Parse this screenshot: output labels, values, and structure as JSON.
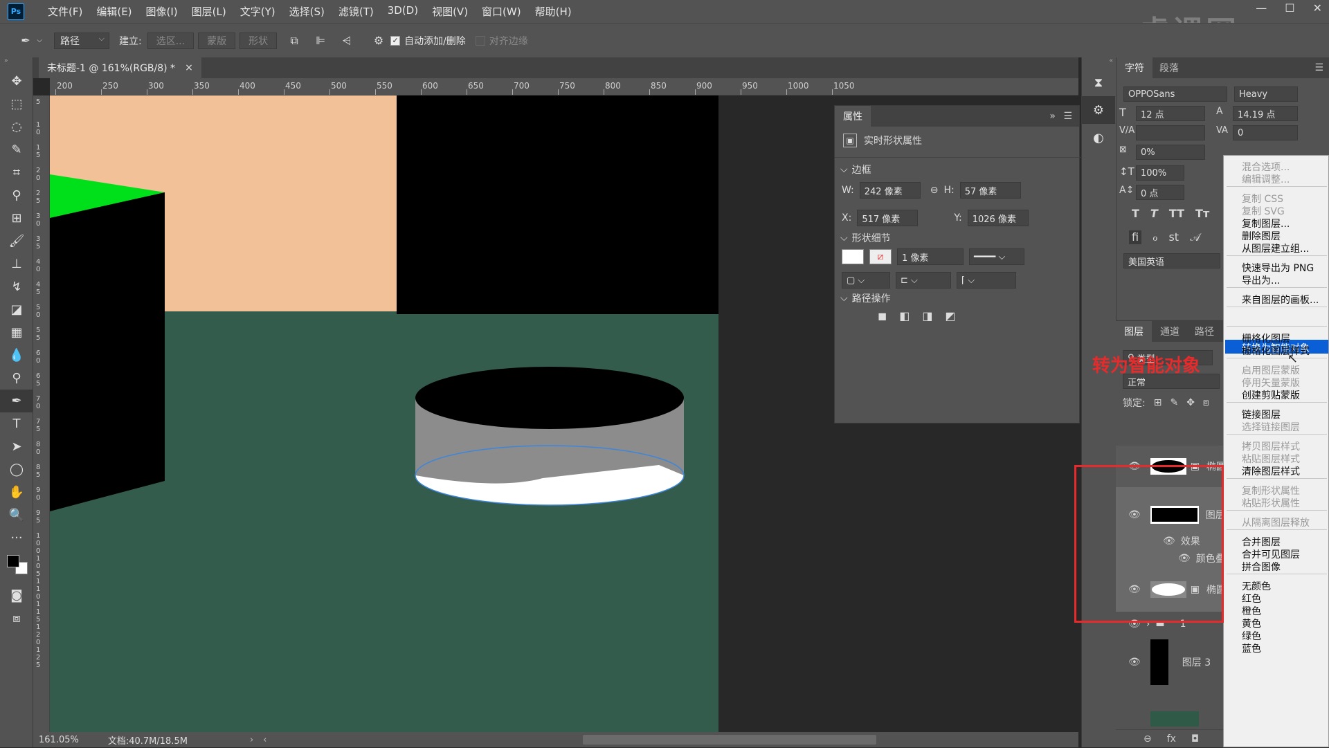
{
  "menubar": {
    "logo": "Ps",
    "items": [
      "文件(F)",
      "编辑(E)",
      "图像(I)",
      "图层(L)",
      "文字(Y)",
      "选择(S)",
      "滤镜(T)",
      "3D(D)",
      "视图(V)",
      "窗口(W)",
      "帮助(H)"
    ]
  },
  "options": {
    "mode": "路径",
    "build_label": "建立:",
    "selection_btn": "选区...",
    "mask_btn": "蒙版",
    "shape_btn": "形状",
    "auto_add": "自动添加/删除",
    "align_edges": "对齐边缘"
  },
  "tab": {
    "title": "未标题-1 @ 161%(RGB/8) *",
    "close": "×"
  },
  "ruler": [
    "200",
    "250",
    "300",
    "350",
    "400",
    "450",
    "500",
    "550",
    "600",
    "650",
    "700",
    "750",
    "800",
    "850",
    "900",
    "950",
    "1000",
    "1050"
  ],
  "vruler": [
    "5",
    "1 0",
    "1 5",
    "2 0",
    "2 5",
    "3 0",
    "3 5",
    "4 0",
    "4 5",
    "5 0",
    "5 5",
    "6 0",
    "6 5",
    "7 0",
    "7 5",
    "8 0",
    "8 5",
    "9 0",
    "9 5",
    "1 0 0",
    "1 0 5",
    "1 1 0",
    "1 1 5",
    "1 2 0",
    "1 2 5"
  ],
  "status": {
    "zoom": "161.05%",
    "doc": "文档:40.7M/18.5M"
  },
  "props": {
    "tab": "属性",
    "header": "实时形状属性",
    "section_bounds": "边框",
    "w_label": "W:",
    "w": "242 像素",
    "h_label": "H:",
    "h": "57 像素",
    "x_label": "X:",
    "x": "517 像素",
    "y_label": "Y:",
    "y": "1026 像素",
    "section_shape": "形状细节",
    "stroke_width": "1 像素",
    "section_path": "路径操作"
  },
  "char": {
    "tab1": "字符",
    "tab2": "段落",
    "font": "OPPOSans",
    "style": "Heavy",
    "size": "12 点",
    "leading": "14.19 点",
    "kerning": "0",
    "tracking": "0%",
    "scale": "100%",
    "baseline": "0 点",
    "lang": "美国英语"
  },
  "layers": {
    "tab1": "图层",
    "tab2": "通道",
    "tab3": "路径",
    "kind": "类型",
    "blend": "正常",
    "lock": "锁定:",
    "rows": [
      {
        "name": "椭圆"
      },
      {
        "name": "图层"
      },
      {
        "name": "效果"
      },
      {
        "name": "颜色叠"
      },
      {
        "name": "椭圆"
      },
      {
        "name": "1"
      },
      {
        "name": "图层 3"
      }
    ]
  },
  "menu": [
    {
      "label": "混合选项...",
      "disabled": true
    },
    {
      "label": "编辑调整...",
      "disabled": true
    },
    {
      "label": "复制 CSS",
      "disabled": true
    },
    {
      "label": "复制 SVG",
      "disabled": true
    },
    {
      "label": "复制图层...",
      "disabled": false
    },
    {
      "label": "删除图层",
      "disabled": false
    },
    {
      "label": "从图层建立组...",
      "disabled": false
    },
    {
      "label": "快速导出为 PNG",
      "disabled": false
    },
    {
      "label": "导出为...",
      "disabled": false
    },
    {
      "label": "来自图层的画板...",
      "disabled": false
    },
    {
      "label": "转换为智能对象",
      "disabled": false,
      "highlight": true
    },
    {
      "label": "栅格化图层",
      "disabled": false
    },
    {
      "label": "栅格化图层样式",
      "disabled": false
    },
    {
      "label": "启用图层蒙版",
      "disabled": true
    },
    {
      "label": "停用矢量蒙版",
      "disabled": true
    },
    {
      "label": "创建剪贴蒙版",
      "disabled": false
    },
    {
      "label": "链接图层",
      "disabled": false
    },
    {
      "label": "选择链接图层",
      "disabled": true
    },
    {
      "label": "拷贝图层样式",
      "disabled": true
    },
    {
      "label": "粘贴图层样式",
      "disabled": true
    },
    {
      "label": "清除图层样式",
      "disabled": false
    },
    {
      "label": "复制形状属性",
      "disabled": true
    },
    {
      "label": "粘贴形状属性",
      "disabled": true
    },
    {
      "label": "从隔离图层释放",
      "disabled": true
    },
    {
      "label": "合并图层",
      "disabled": false
    },
    {
      "label": "合并可见图层",
      "disabled": false
    },
    {
      "label": "拼合图像",
      "disabled": false
    },
    {
      "label": "无颜色",
      "disabled": false
    },
    {
      "label": "红色",
      "disabled": false
    },
    {
      "label": "橙色",
      "disabled": false
    },
    {
      "label": "黄色",
      "disabled": false
    },
    {
      "label": "绿色",
      "disabled": false
    },
    {
      "label": "蓝色",
      "disabled": false
    }
  ],
  "annotation": {
    "text": "转为智能对象"
  },
  "colors": {
    "peach": "#f2c197",
    "green_floor": "#335c4c",
    "bright_green": "#00e01a",
    "highlight": "#0a5fd6",
    "annotation": "#e52b2b"
  }
}
